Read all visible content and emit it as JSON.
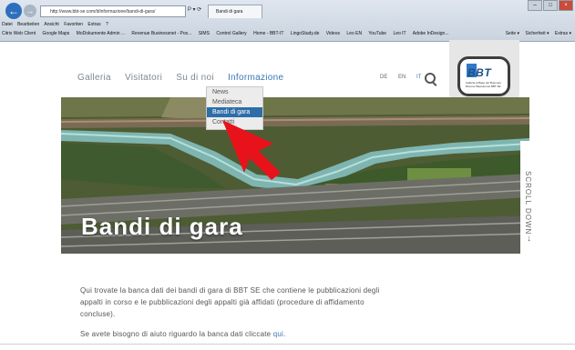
{
  "browser": {
    "address": "http://www.bbt-se.com/it/informazione/bandi-di-gara/",
    "address_controls": "P ▾ ⟳",
    "tab_title": "Bandi di gara",
    "menubar": [
      "Datei",
      "Bearbeiten",
      "Ansicht",
      "Favoriten",
      "Extras",
      "?"
    ],
    "favorites": [
      "Citrix Web Client",
      "Google Maps",
      "MoDokumente Admin ...",
      "Revenue Businessnet - Pos...",
      "SIMS",
      "Control Gallery",
      "Home - BBT-IT",
      "LingoStudy.de",
      "Videos",
      "Leo EN",
      "YouTube",
      "Leo IT",
      "Adobe InDesign..."
    ],
    "tools": [
      "Seite ▾",
      "Sicherheit ▾",
      "Extras ▾"
    ]
  },
  "nav": {
    "items": [
      "Galleria",
      "Visitatori",
      "Su di noi",
      "Informazione"
    ],
    "active": "Informazione",
    "languages": [
      "DE",
      "EN",
      "IT"
    ],
    "active_language": "IT"
  },
  "logo": {
    "text": "BBT",
    "subtitle": "Galleria di Base del Brennero Brenner Basistunnel BBT SE"
  },
  "dropdown": {
    "items": [
      "News",
      "Mediateca",
      "Bandi di gara",
      "Contatti"
    ],
    "active": "Bandi di gara"
  },
  "hero": {
    "title": "Bandi di gara",
    "scroll_label": "SCROLL DOWN",
    "scroll_arrow": "↓"
  },
  "content": {
    "intro": "Qui trovate la banca dati dei bandi di gara di BBT SE che contiene le pubblicazioni degli appalti in corso e le pubblicazioni degli appalti già affidati (procedure di affidamento concluse).",
    "help_text": "Se avete bisogno di aiuto riguardo la banca dati cliccate ",
    "help_link": "qui",
    "help_end": "."
  },
  "colors": {
    "accent": "#3b77b5",
    "pointer": "#e8121a",
    "dropdown_active": "#2e6ea8"
  }
}
